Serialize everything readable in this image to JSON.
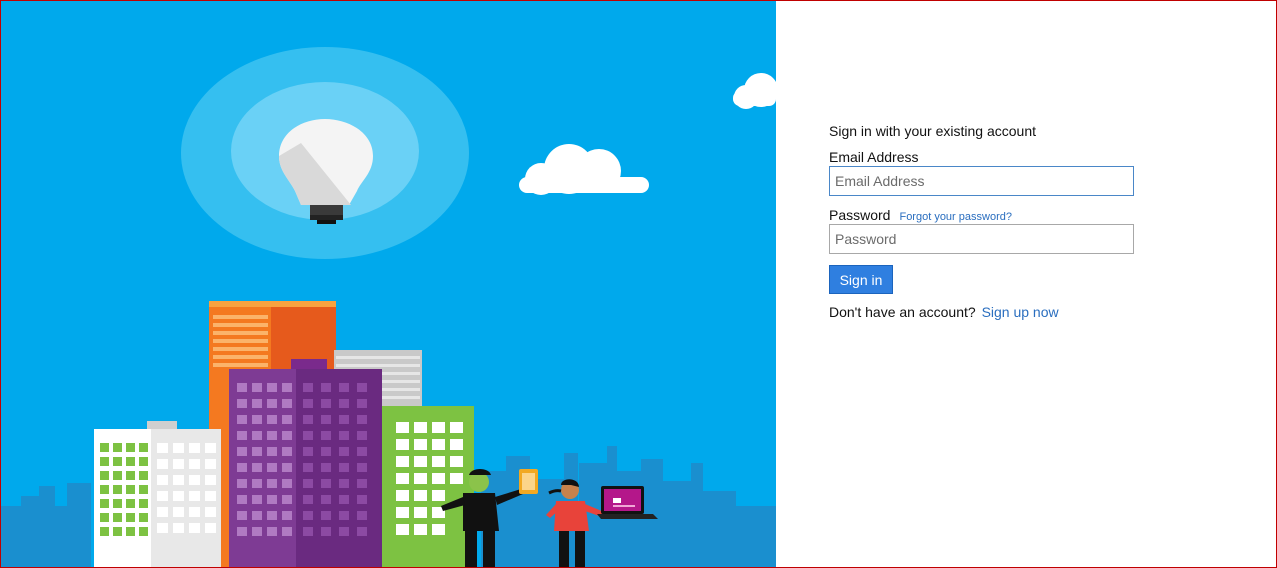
{
  "form": {
    "heading": "Sign in with your existing account",
    "email_label": "Email Address",
    "email_placeholder": "Email Address",
    "password_label": "Password",
    "forgot_link": "Forgot your password?",
    "password_placeholder": "Password",
    "signin_label": "Sign in",
    "signup_prompt": "Don't have an account?",
    "signup_link": "Sign up now"
  },
  "colors": {
    "hero_background": "#00a9ec",
    "button": "#2f7fe0",
    "link": "#2a6ebf"
  }
}
